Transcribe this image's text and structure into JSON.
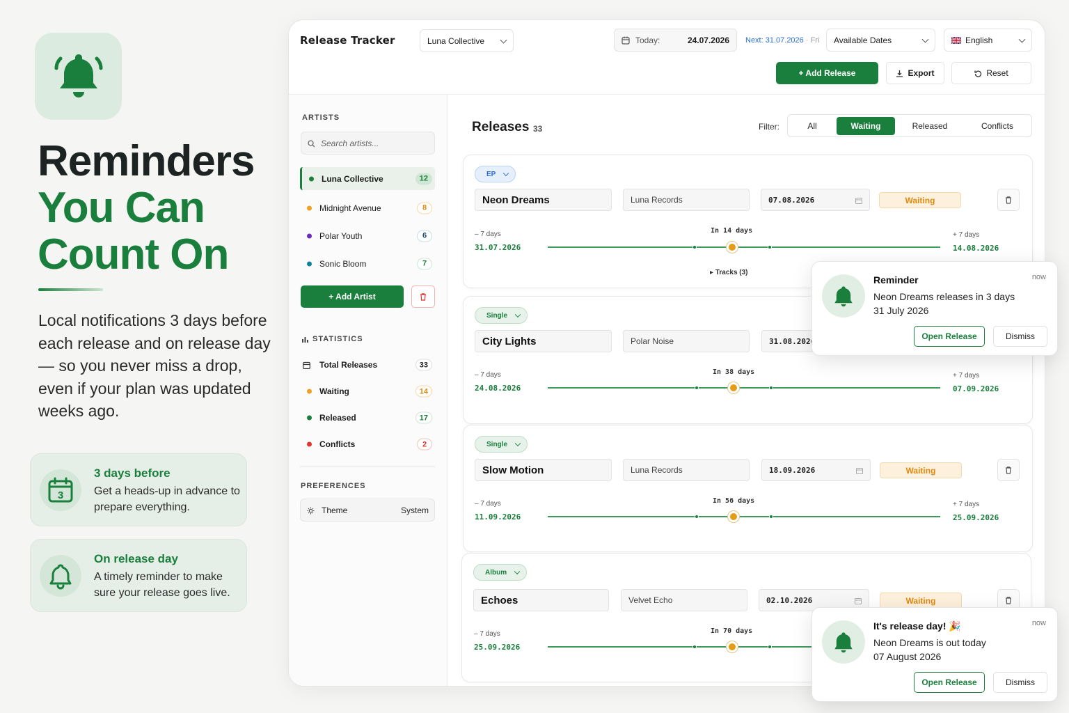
{
  "promo": {
    "title_line1": "Reminders",
    "title_line2": "You Can",
    "title_line3": "Count On",
    "description": "Local notifications 3 days before each release and on release day — so you never miss a drop, even if your plan was updated weeks ago.",
    "features": [
      {
        "icon": "calendar-3-icon",
        "calendar_number": "3",
        "title": "3 days before",
        "text": "Get a heads-up in advance to prepare everything."
      },
      {
        "icon": "bell-outline-icon",
        "title": "On release day",
        "text": "A timely reminder to make sure your release goes live."
      }
    ]
  },
  "app": {
    "brand": "Release Tracker",
    "artist_select": "Luna Collective",
    "today_label": "Today:",
    "today_value": "24.07.2026",
    "next_label": "Next: 31.07.2026",
    "next_day": "· Fri",
    "dates_select": "Available Dates",
    "language": "English",
    "add_release": "+ Add Release",
    "export": "Export",
    "reset": "Reset"
  },
  "sidebar": {
    "artists_heading": "ARTISTS",
    "search_placeholder": "Search artists...",
    "artists": [
      {
        "name": "Luna Collective",
        "count": "12",
        "color": "#1a7f3c"
      },
      {
        "name": "Midnight Avenue",
        "count": "8",
        "color": "#f0a022"
      },
      {
        "name": "Polar Youth",
        "count": "6",
        "color": "#6a2bb8"
      },
      {
        "name": "Sonic Bloom",
        "count": "7",
        "color": "#13809a"
      }
    ],
    "add_artist": "+ Add Artist",
    "statistics_heading": "STATISTICS",
    "stats": [
      {
        "label": "Total Releases",
        "count": "33"
      },
      {
        "label": "Waiting",
        "count": "14",
        "color": "#f0a022"
      },
      {
        "label": "Released",
        "count": "17",
        "color": "#1a7f3c"
      },
      {
        "label": "Conflicts",
        "count": "2",
        "color": "#e0342c"
      }
    ],
    "preferences_heading": "PREFERENCES",
    "theme_label": "Theme",
    "theme_value": "System"
  },
  "main": {
    "title": "Releases",
    "count": "33",
    "filter_label": "Filter:",
    "filters": [
      "All",
      "Waiting",
      "Released",
      "Conflicts"
    ],
    "active_filter": "Waiting",
    "releases": [
      {
        "type": "EP",
        "name": "Neon Dreams",
        "label": "Luna Records",
        "date": "07.08.2026",
        "status": "Waiting",
        "before_label": "– 7 days",
        "before_date": "31.07.2026",
        "center": "In 14 days",
        "after_label": "+ 7 days",
        "after_date": "14.08.2026",
        "tracks": "Tracks (3)"
      },
      {
        "type": "Single",
        "name": "City Lights",
        "label": "Polar Noise",
        "date": "31.08.2026",
        "status": "",
        "before_label": "– 7 days",
        "before_date": "24.08.2026",
        "center": "In 38 days",
        "after_label": "+ 7 days",
        "after_date": "07.09.2026"
      },
      {
        "type": "Single",
        "name": "Slow Motion",
        "label": "Luna Records",
        "date": "18.09.2026",
        "status": "Waiting",
        "before_label": "– 7 days",
        "before_date": "11.09.2026",
        "center": "In 56 days",
        "after_label": "+ 7 days",
        "after_date": "25.09.2026"
      },
      {
        "type": "Album",
        "name": "Echoes",
        "label": "Velvet Echo",
        "date": "02.10.2026",
        "status": "Waiting",
        "before_label": "– 7 days",
        "before_date": "25.09.2026",
        "center": "In 70 days"
      }
    ]
  },
  "notifications": [
    {
      "title": "Reminder",
      "time": "now",
      "line1": "Neon Dreams releases in 3 days",
      "line2": "31 July 2026",
      "open": "Open Release",
      "dismiss": "Dismiss"
    },
    {
      "title": "It's release day! 🎉",
      "time": "now",
      "line1": "Neon Dreams is out today",
      "line2": "07 August 2026",
      "open": "Open Release",
      "dismiss": "Dismiss"
    }
  ],
  "colors": {
    "accent": "#1a7f3c",
    "waiting": "#e08a10",
    "conflict": "#e0342c"
  }
}
